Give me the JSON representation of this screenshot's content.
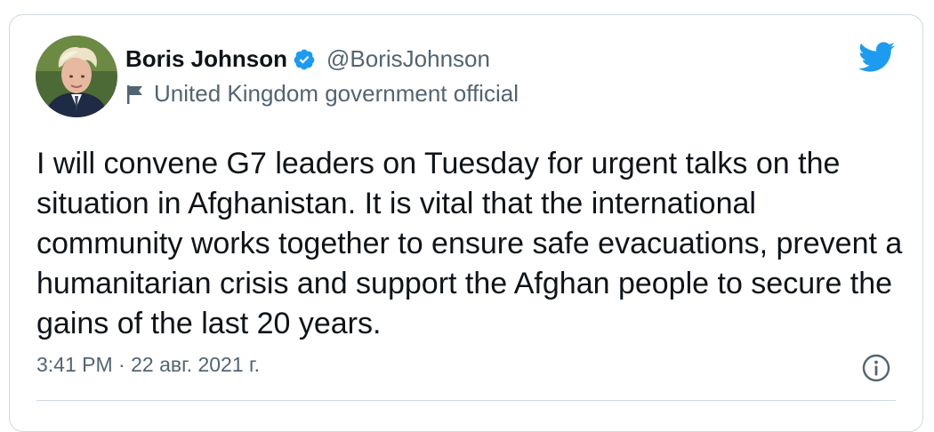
{
  "tweet": {
    "author": {
      "display_name": "Boris Johnson",
      "handle": "@BorisJohnson",
      "verified": true,
      "affiliation_label": "United Kingdom government official",
      "avatar_icon": "person-avatar"
    },
    "text": "I will convene G7 leaders on Tuesday for urgent talks on the situation in Afghanistan. It is vital that the international community works together to ensure safe evacuations, prevent a humanitarian crisis and support the Afghan people to secure the gains of the last 20 years.",
    "timestamp": "3:41 PM · 22 авг. 2021 г.",
    "icons": {
      "verified": "verified-badge-icon",
      "affiliation": "flag-icon",
      "brand": "twitter-bird-icon",
      "info": "info-icon"
    }
  },
  "colors": {
    "brand_blue": "#1d9bf0",
    "text_primary": "#0f1419",
    "text_secondary": "#536471",
    "border": "#cfd9de"
  }
}
